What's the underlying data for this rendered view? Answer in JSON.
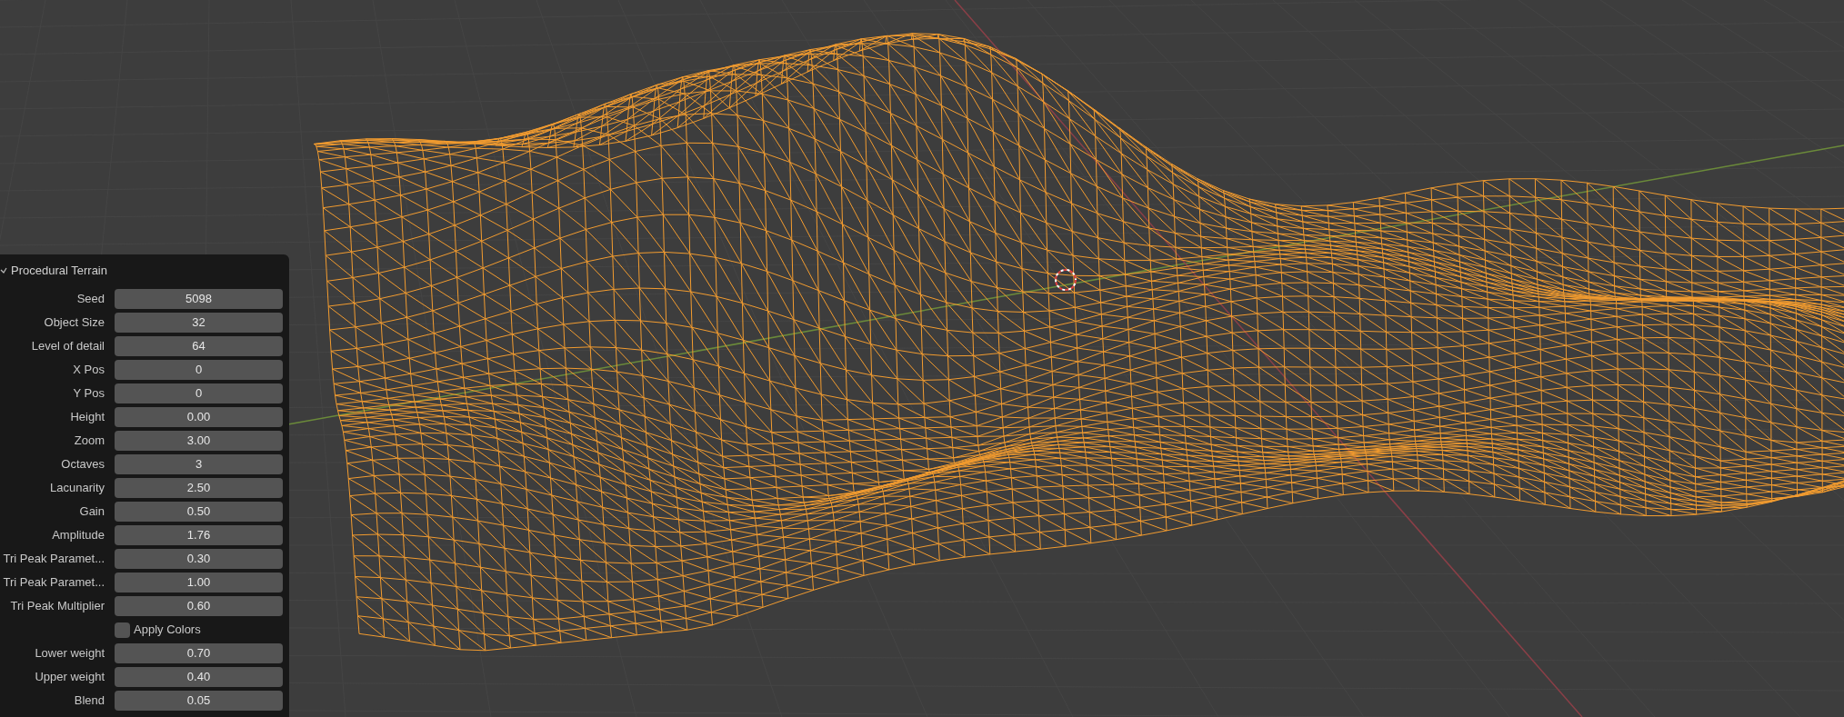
{
  "panel": {
    "title": "Procedural Terrain",
    "expanded": true,
    "rows": [
      {
        "kind": "number",
        "label": "Seed",
        "value": "5098"
      },
      {
        "kind": "number",
        "label": "Object Size",
        "value": "32"
      },
      {
        "kind": "number",
        "label": "Level of detail",
        "value": "64"
      },
      {
        "kind": "number",
        "label": "X Pos",
        "value": "0"
      },
      {
        "kind": "number",
        "label": "Y Pos",
        "value": "0"
      },
      {
        "kind": "number",
        "label": "Height",
        "value": "0.00"
      },
      {
        "kind": "number",
        "label": "Zoom",
        "value": "3.00"
      },
      {
        "kind": "number",
        "label": "Octaves",
        "value": "3"
      },
      {
        "kind": "number",
        "label": "Lacunarity",
        "value": "2.50"
      },
      {
        "kind": "number",
        "label": "Gain",
        "value": "0.50"
      },
      {
        "kind": "number",
        "label": "Amplitude",
        "value": "1.76"
      },
      {
        "kind": "number",
        "label": "Tri Peak Paramet...",
        "value": "0.30"
      },
      {
        "kind": "number",
        "label": "Tri Peak Paramet...",
        "value": "1.00"
      },
      {
        "kind": "number",
        "label": "Tri Peak Multiplier",
        "value": "0.60"
      },
      {
        "kind": "checkbox",
        "label": "Apply Colors",
        "checked": false
      },
      {
        "kind": "number",
        "label": "Lower weight",
        "value": "0.70"
      },
      {
        "kind": "number",
        "label": "Upper weight",
        "value": "0.40"
      },
      {
        "kind": "number",
        "label": "Blend",
        "value": "0.05"
      }
    ]
  }
}
